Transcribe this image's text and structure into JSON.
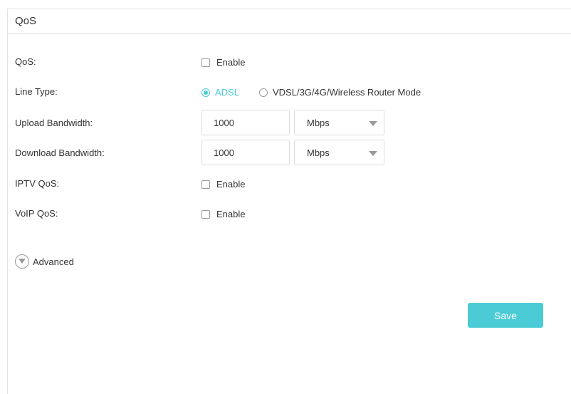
{
  "panel": {
    "title": "QoS"
  },
  "qos": {
    "label": "QoS:",
    "checkbox_label": "Enable",
    "checked": false
  },
  "line_type": {
    "label": "Line Type:",
    "options": [
      {
        "label": "ADSL",
        "selected": true
      },
      {
        "label": "VDSL/3G/4G/Wireless Router Mode",
        "selected": false
      }
    ]
  },
  "upload": {
    "label": "Upload Bandwidth:",
    "value": "1000",
    "unit": "Mbps"
  },
  "download": {
    "label": "Download Bandwidth:",
    "value": "1000",
    "unit": "Mbps"
  },
  "iptv": {
    "label": "IPTV QoS:",
    "checkbox_label": "Enable",
    "checked": false
  },
  "voip": {
    "label": "VoIP QoS:",
    "checkbox_label": "Enable",
    "checked": false
  },
  "advanced": {
    "label": "Advanced",
    "icon": "chevron-down-circle-icon"
  },
  "actions": {
    "save_label": "Save"
  },
  "colors": {
    "accent": "#4acbd6",
    "border": "#dcdcdc",
    "text": "#333333"
  }
}
